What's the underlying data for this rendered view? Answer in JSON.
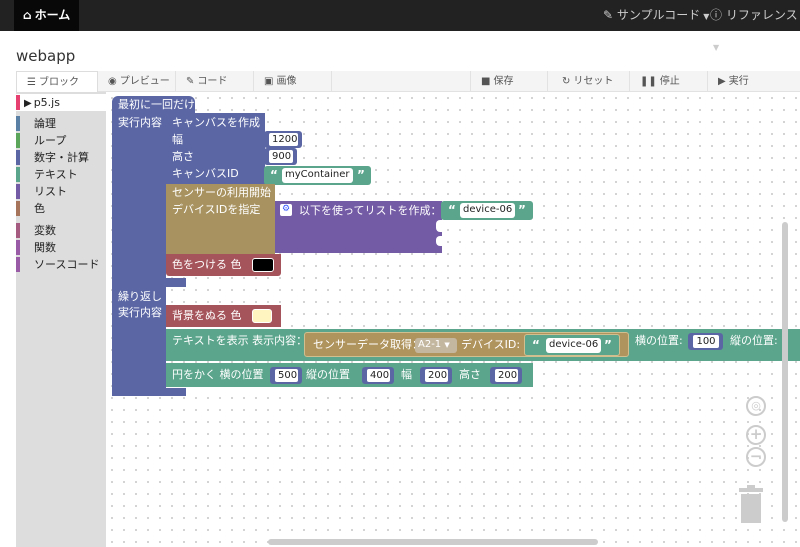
{
  "navbar": {
    "home_label": "ホーム",
    "sample_code_label": "サンプルコード",
    "reference_label": "リファレンス"
  },
  "app": {
    "title": "webapp"
  },
  "tabs": {
    "blocks": "ブロック",
    "preview": "プレビュー",
    "code": "コード",
    "image": "画像",
    "save": "保存",
    "reset": "リセット",
    "stop": "停止",
    "run": "実行"
  },
  "toolbox": {
    "items": [
      {
        "label": "p5.js",
        "color": "#e64070"
      },
      {
        "label": "論理",
        "color": "#5b80a5"
      },
      {
        "label": "ループ",
        "color": "#5ba55b"
      },
      {
        "label": "数字・計算",
        "color": "#5b67a5"
      },
      {
        "label": "テキスト",
        "color": "#5ba58c"
      },
      {
        "label": "リスト",
        "color": "#745ba5"
      },
      {
        "label": "色",
        "color": "#a5745b"
      },
      {
        "label": "変数",
        "color": "#a55b80"
      },
      {
        "label": "関数",
        "color": "#995ba5"
      },
      {
        "label": "ソースコード",
        "color": "#995ba5"
      }
    ]
  },
  "blocks": {
    "setup_label": "最初に一回だけ",
    "exec_label": "実行内容",
    "create_canvas": "キャンバスを作成",
    "width": "幅",
    "height": "高さ",
    "canvas_id": "キャンバスID",
    "canvas_width_value": "1200",
    "canvas_height_value": "900",
    "container_value": "myContainer",
    "sensor_start": "センサーの利用開始",
    "device_id_set": "デバイスIDを指定",
    "list_create": "以下を使ってリストを作成：",
    "device_value": "device-06",
    "fill_label": "色をつける 色",
    "fill_color": "#000000",
    "loop_label": "繰り返し",
    "loop_exec_label": "実行内容",
    "bg_label": "背景をぬる 色",
    "bg_color": "#fff5c0",
    "text_label": "テキストを表示 表示内容：",
    "sensor_get": "センサーデータ取得：",
    "sensor_select": "A2-1",
    "device_id_label": "デバイスID:",
    "device_value2": "device-06",
    "x_pos_label": "横の位置:",
    "x_pos_value": "100",
    "y_pos_label": "縦の位置:",
    "circle_label": "円をかく 横の位置",
    "circle_x": "500",
    "circle_y_label": "縦の位置",
    "circle_y": "400",
    "circle_w_label": "幅",
    "circle_w": "200",
    "circle_h_label": "高さ",
    "circle_h": "200"
  }
}
